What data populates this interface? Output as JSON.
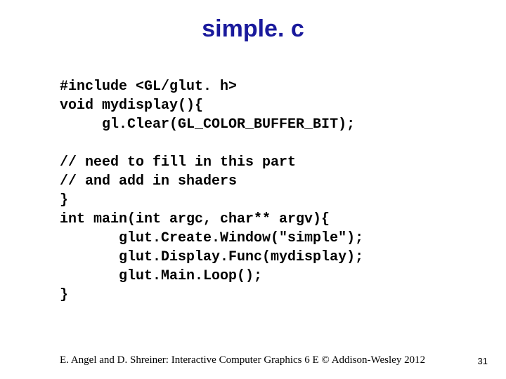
{
  "title": "simple. c",
  "code": {
    "l1": "#include <GL/glut. h>",
    "l2": "void mydisplay(){",
    "l3": "     gl.Clear(GL_COLOR_BUFFER_BIT);",
    "l4": "",
    "l5": "// need to fill in this part",
    "l6": "// and add in shaders",
    "l7": "}",
    "l8": "int main(int argc, char** argv){",
    "l9": "       glut.Create.Window(\"simple\");",
    "l10": "       glut.Display.Func(mydisplay);",
    "l11": "       glut.Main.Loop();",
    "l12": "}"
  },
  "footer": "E. Angel and D. Shreiner: Interactive Computer Graphics 6 E © Addison-Wesley 2012",
  "page": "31"
}
